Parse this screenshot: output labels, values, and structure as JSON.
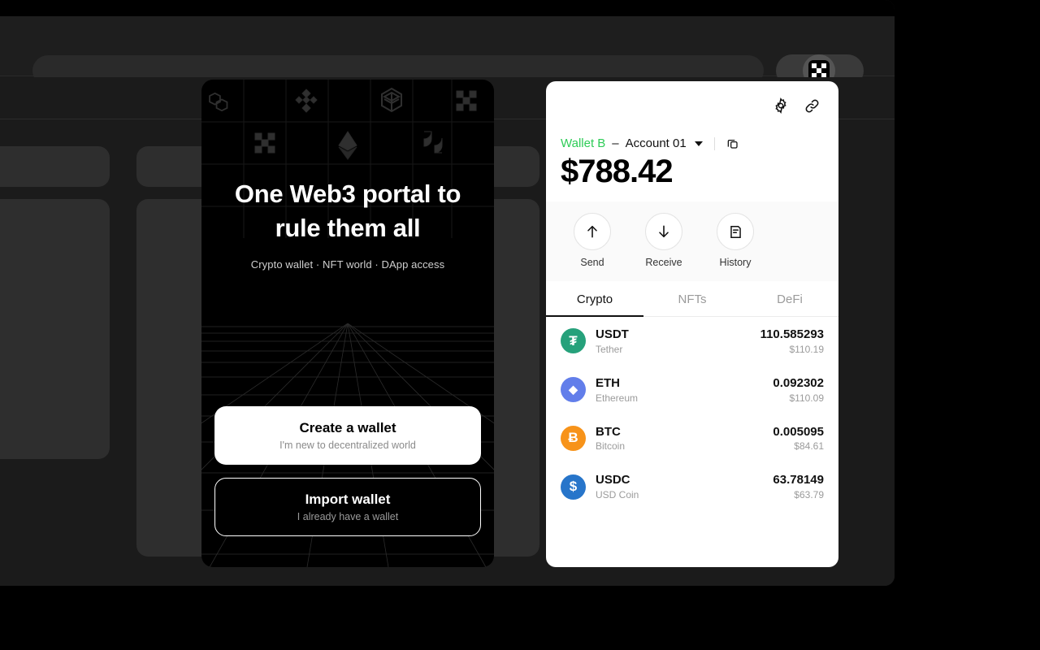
{
  "browser": {
    "address_value": "",
    "address_placeholder": "",
    "extension_icon": "okx-wallet-extension-icon"
  },
  "onboarding": {
    "hero_title": "One Web3 portal to rule them all",
    "hero_subtitle": "Crypto wallet · NFT world · DApp access",
    "create": {
      "title": "Create a wallet",
      "subtitle": "I'm new to decentralized world"
    },
    "import": {
      "title": "Import wallet",
      "subtitle": "I already have a wallet"
    },
    "logos": [
      "polygon-icon",
      "binance-icon",
      "fantom-icon",
      "okx-icon",
      "okx-icon",
      "ethereum-icon",
      "polkadot-icon"
    ]
  },
  "wallet": {
    "settings_icon": "gear-icon",
    "link_icon": "link-chain-icon",
    "copy_icon": "copy-icon",
    "wallet_label": "Wallet B",
    "wallet_separator": "–",
    "account_label": "Account 01",
    "balance": "$788.42",
    "wallet_color": "#2ecc57",
    "actions": [
      {
        "label": "Send",
        "icon": "arrow-up-icon"
      },
      {
        "label": "Receive",
        "icon": "arrow-down-icon"
      },
      {
        "label": "History",
        "icon": "document-list-icon"
      }
    ],
    "tabs": [
      {
        "label": "Crypto",
        "active": true
      },
      {
        "label": "NFTs",
        "active": false
      },
      {
        "label": "DeFi",
        "active": false
      }
    ],
    "tokens": [
      {
        "symbol": "USDT",
        "name": "Tether",
        "amount": "110.585293",
        "fiat": "$110.19",
        "color": "#26A17B",
        "glyph": "₮"
      },
      {
        "symbol": "ETH",
        "name": "Ethereum",
        "amount": "0.092302",
        "fiat": "$110.09",
        "color": "#627EEA",
        "glyph": "◆"
      },
      {
        "symbol": "BTC",
        "name": "Bitcoin",
        "amount": "0.005095",
        "fiat": "$84.61",
        "color": "#F7931A",
        "glyph": "Ƀ"
      },
      {
        "symbol": "USDC",
        "name": "USD Coin",
        "amount": "63.78149",
        "fiat": "$63.79",
        "color": "#2775CA",
        "glyph": "$"
      }
    ]
  }
}
